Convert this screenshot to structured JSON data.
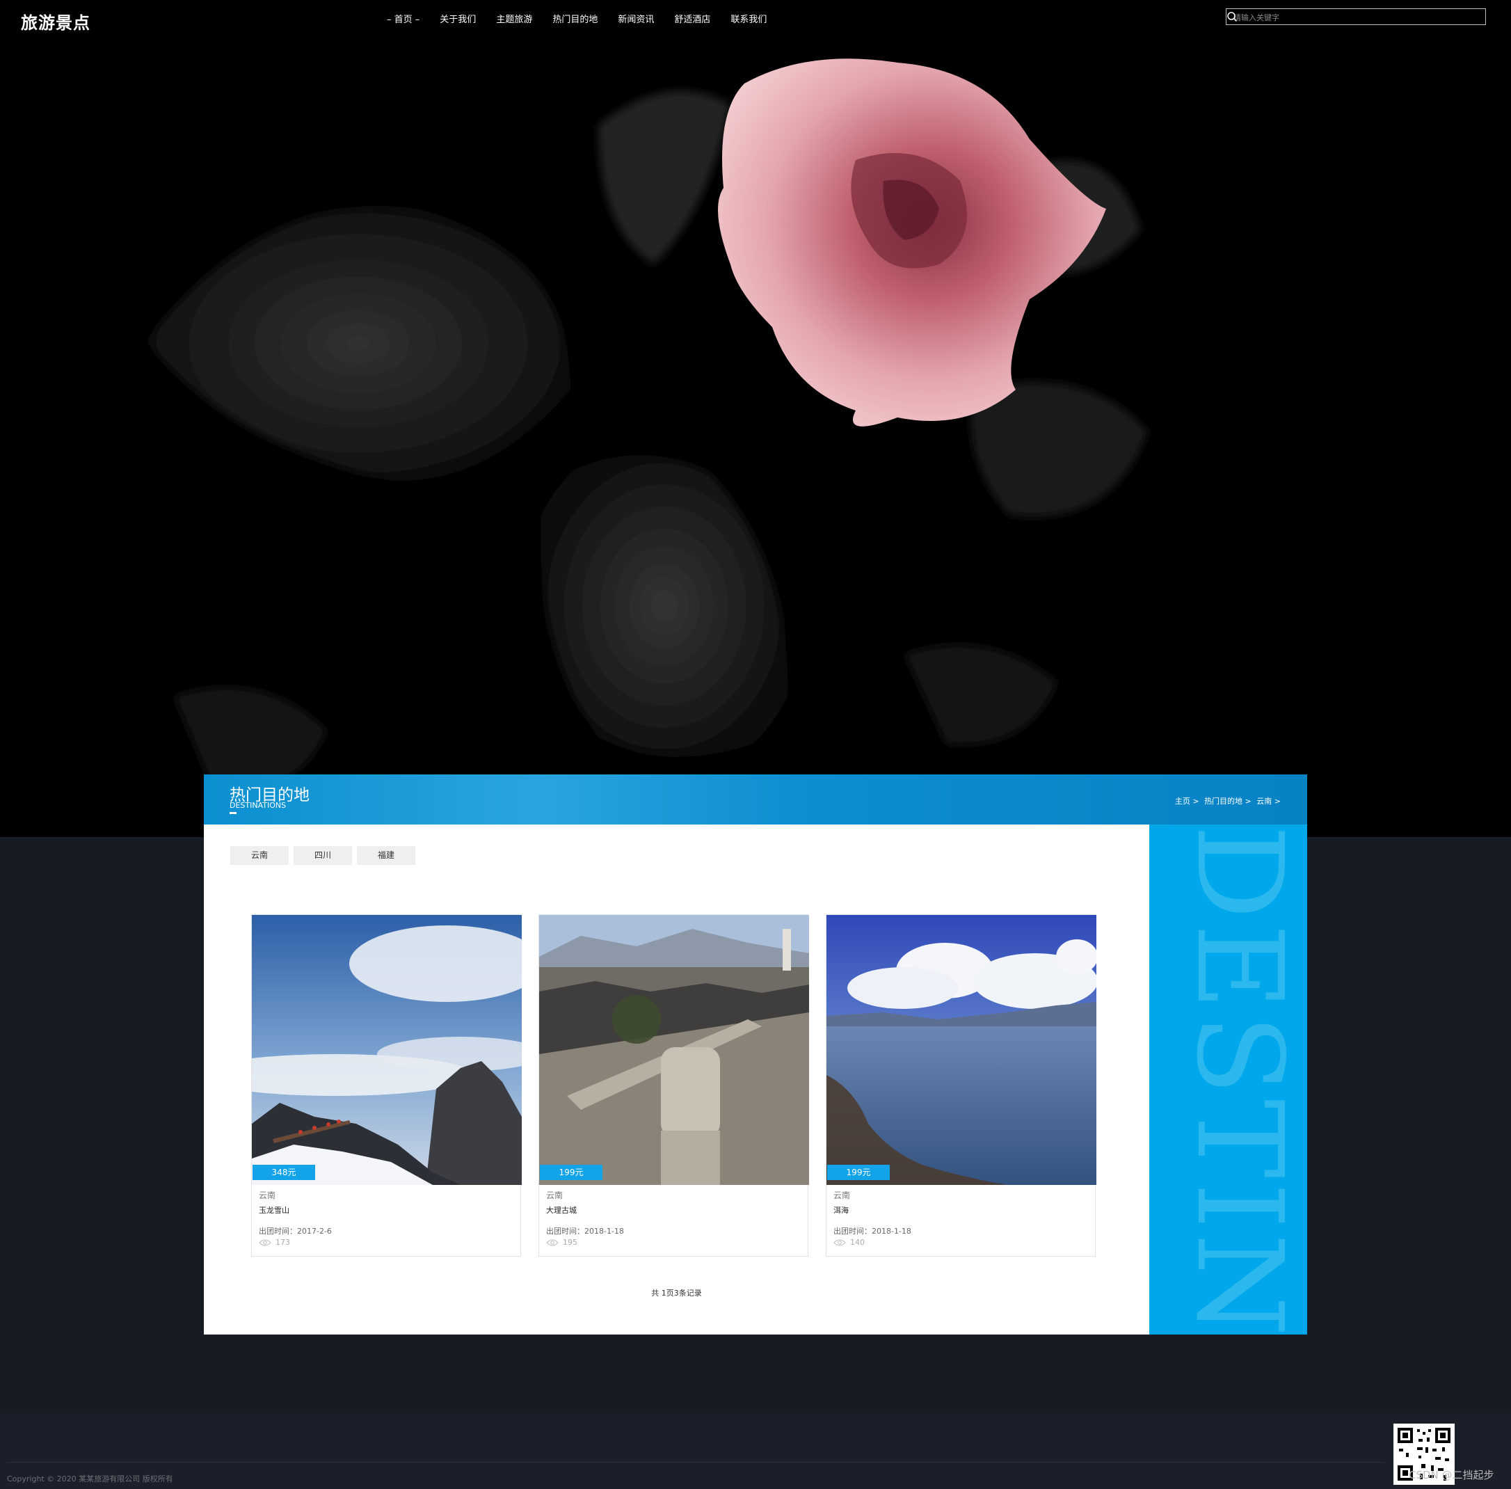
{
  "brand": {
    "logo": "旅游景点"
  },
  "nav": {
    "items": [
      "首页",
      "关于我们",
      "主题旅游",
      "热门目的地",
      "新闻资讯",
      "舒适酒店",
      "联系我们"
    ]
  },
  "search": {
    "placeholder": "请输入关键字",
    "icon": "search-icon"
  },
  "section": {
    "title": "热门目的地",
    "subtitle": "DESTINATIONS",
    "breadcrumb": [
      "主页 >",
      "热门目的地 >",
      "云南 >"
    ],
    "watermark": "DESTINAT"
  },
  "filters": [
    "云南",
    "四川",
    "福建"
  ],
  "cards": [
    {
      "price": "348元",
      "region": "云南",
      "name": "玉龙雪山",
      "date": "出团时间：2017-2-6",
      "views": "173"
    },
    {
      "price": "199元",
      "region": "云南",
      "name": "大理古城",
      "date": "出团时间：2018-1-18",
      "views": "195"
    },
    {
      "price": "199元",
      "region": "云南",
      "name": "洱海",
      "date": "出团时间：2018-1-18",
      "views": "140"
    }
  ],
  "pager": "共 1页3条记录",
  "footer": {
    "copyright": "Copyright © 2020 某某旅游有限公司 版权所有",
    "watermark": "CSDN @二挡起步"
  },
  "colors": {
    "accent": "#00a7ea",
    "header_blue": "#0a8fd0",
    "page_bg": "#161b24",
    "footer_bg": "#1b1f29"
  }
}
